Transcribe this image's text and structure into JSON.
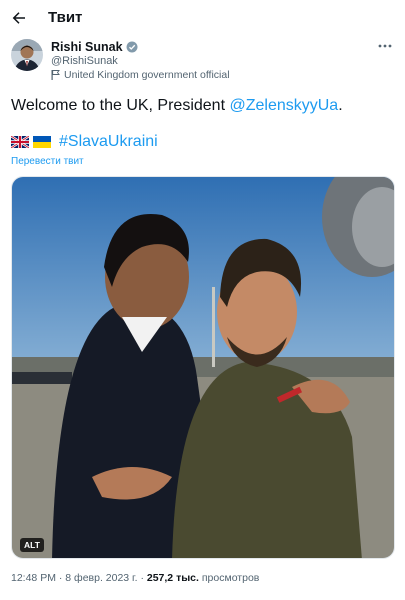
{
  "header": {
    "title": "Твит"
  },
  "author": {
    "name": "Rishi Sunak",
    "handle": "@RishiSunak",
    "affiliation": "United Kingdom government official"
  },
  "tweet": {
    "text_prefix": "Welcome to the UK, President ",
    "mention": "@ZelenskyyUa",
    "text_suffix": ".",
    "hashtag": "#SlavaUkraini",
    "translate_label": "Перевести твит"
  },
  "media": {
    "alt_label": "ALT"
  },
  "meta": {
    "time": "12:48 PM",
    "separator": " · ",
    "date": "8 февр. 2023 г.",
    "views_count": "257,2 тыс.",
    "views_label": " просмотров"
  },
  "colors": {
    "accent": "#1d9bf0",
    "verified": "#829aab",
    "muted": "#536471"
  },
  "icons": [
    "back-arrow-icon",
    "verified-badge-icon",
    "affiliation-flag-icon",
    "more-dots-icon",
    "uk-flag-icon",
    "ukraine-flag-icon"
  ]
}
